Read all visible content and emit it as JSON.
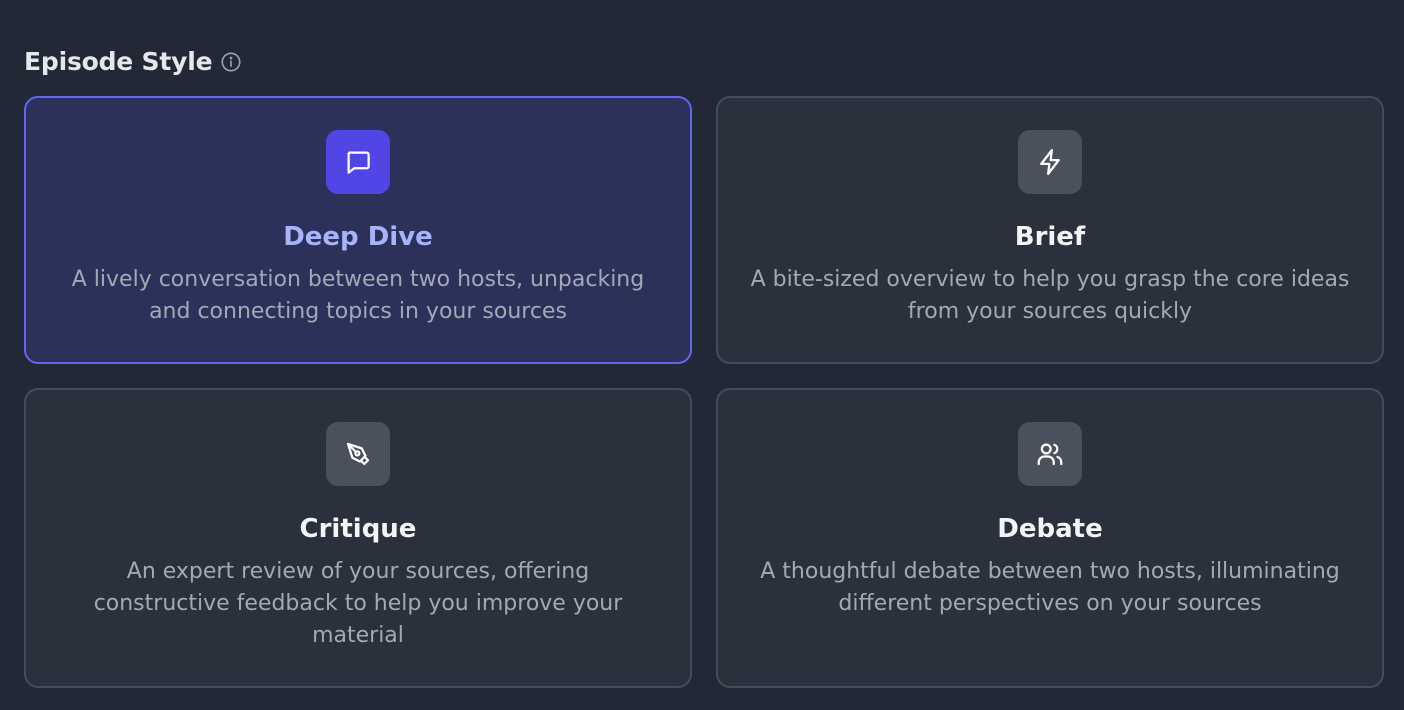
{
  "section": {
    "title": "Episode Style",
    "info_icon": "info-circle-icon"
  },
  "cards": [
    {
      "title": "Deep Dive",
      "description": "A lively conversation between two hosts, unpacking and connecting topics in your sources",
      "icon": "message-square-icon",
      "selected": true
    },
    {
      "title": "Brief",
      "description": "A bite-sized overview to help you grasp the core ideas from your sources quickly",
      "icon": "lightning-icon",
      "selected": false
    },
    {
      "title": "Critique",
      "description": "An expert review of your sources, offering constructive feedback to help you improve your material",
      "icon": "pen-tool-icon",
      "selected": false
    },
    {
      "title": "Debate",
      "description": "A thoughtful debate between two hosts, illuminating different perspectives on your sources",
      "icon": "users-icon",
      "selected": false
    }
  ],
  "colors": {
    "background": "#222835",
    "card_background": "#2a303c",
    "selected_background": "#2c315a",
    "selected_border": "#6366f1",
    "selected_icon_bg": "#4f46e5",
    "selected_title": "#a5b4fc"
  }
}
